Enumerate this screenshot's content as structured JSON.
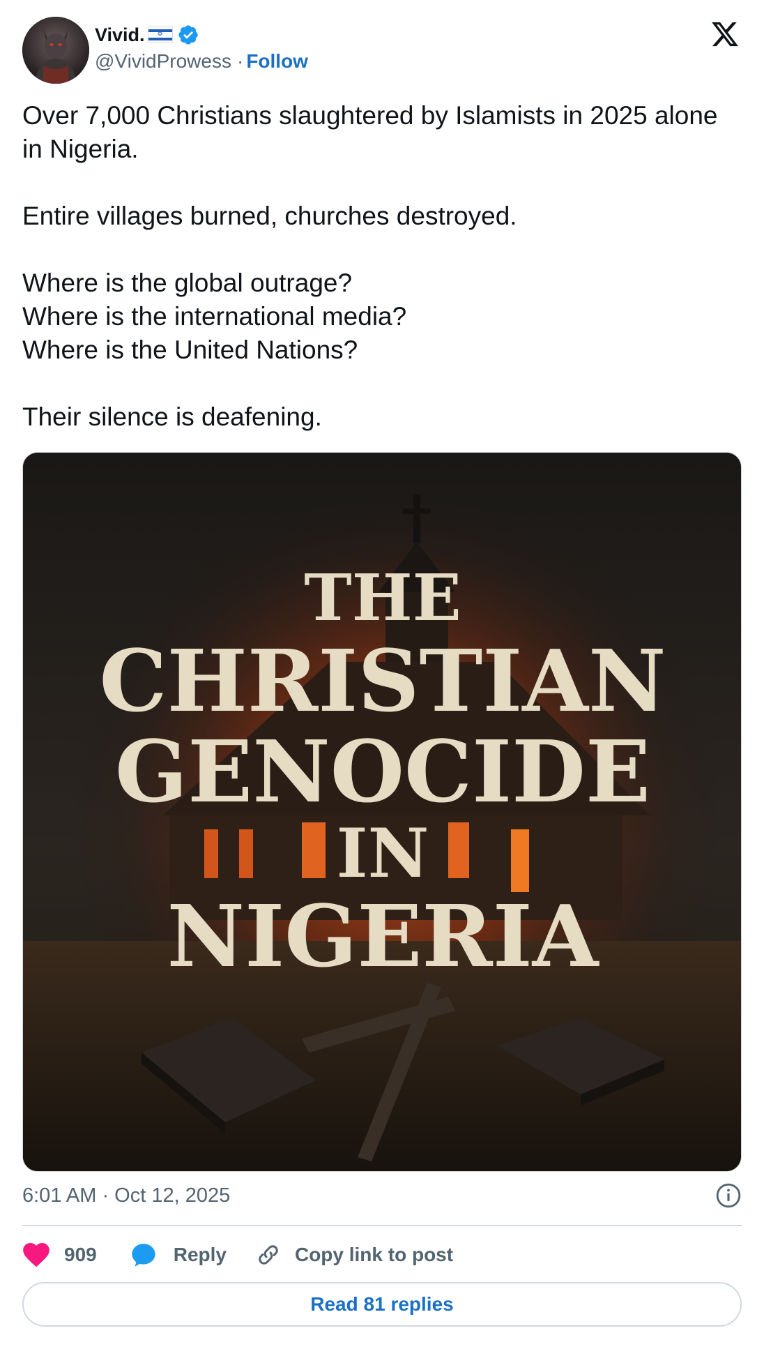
{
  "author": {
    "display_name": "Vivid.",
    "flag": "Israel flag",
    "verified": true,
    "handle": "@VividProwess",
    "separator": "·",
    "follow_label": "Follow"
  },
  "tweet": {
    "text": "Over 7,000 Christians slaughtered by Islamists in 2025 alone in Nigeria.\n\nEntire villages burned, churches destroyed.\n\nWhere is the global outrage?\nWhere is the international media?\nWhere is the United Nations?\n\nTheir silence is deafening.",
    "timestamp": "6:01 AM · Oct 12, 2025"
  },
  "media": {
    "headline_lines": [
      "THE",
      "CHRISTIAN",
      "GENOCIDE",
      "IN",
      "NIGERIA"
    ]
  },
  "actions": {
    "likes_count": "909",
    "reply_label": "Reply",
    "copy_link_label": "Copy link to post",
    "read_replies_label": "Read 81 replies"
  },
  "colors": {
    "link_blue": "#1a70c6",
    "like_pink": "#f91880",
    "reply_blue": "#1d9bf0",
    "muted_text": "#536471"
  },
  "icons": [
    "x-logo-icon",
    "verified-badge-icon",
    "info-icon",
    "heart-icon",
    "reply-bubble-icon",
    "link-icon"
  ]
}
